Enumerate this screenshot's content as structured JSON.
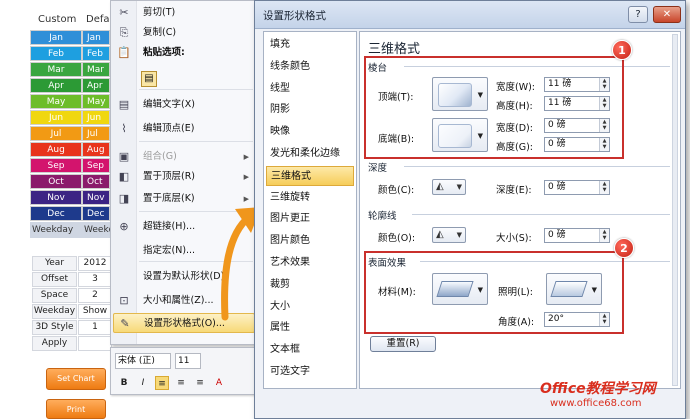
{
  "sheet": {
    "col_custom": "Custom",
    "col_default": "Defau",
    "months": [
      {
        "label": "Jan",
        "color": "#2f8fd8"
      },
      {
        "label": "Feb",
        "color": "#1e9fe0"
      },
      {
        "label": "Mar",
        "color": "#3aa640"
      },
      {
        "label": "Apr",
        "color": "#2c9a35"
      },
      {
        "label": "May",
        "color": "#6dbd2a"
      },
      {
        "label": "Jun",
        "color": "#f0d70f"
      },
      {
        "label": "Jul",
        "color": "#f29a14"
      },
      {
        "label": "Aug",
        "color": "#e8341c"
      },
      {
        "label": "Sep",
        "color": "#d3146d"
      },
      {
        "label": "Oct",
        "color": "#8b1a6b"
      },
      {
        "label": "Nov",
        "color": "#3c2484"
      },
      {
        "label": "Dec",
        "color": "#1e3a8c"
      }
    ],
    "months_default": [
      "Jan",
      "Feb",
      "Mar",
      "Apr",
      "May",
      "Jun",
      "Jul",
      "Aug",
      "Sep",
      "Oct",
      "Nov",
      "Dec"
    ],
    "weekday": "Weekday",
    "weekday2": "Weekd",
    "params": [
      {
        "label": "Year",
        "value": "2012"
      },
      {
        "label": "Offset",
        "value": "3"
      },
      {
        "label": "Space",
        "value": "2"
      },
      {
        "label": "Weekday",
        "value": "Show"
      },
      {
        "label": "3D Style",
        "value": "1"
      },
      {
        "label": "Apply",
        "value": ""
      }
    ],
    "set_chart": "Set Chart",
    "print": "Print"
  },
  "context_menu": {
    "items": [
      {
        "label": "剪切(T)",
        "icon": "✂",
        "name": "cut"
      },
      {
        "label": "复制(C)",
        "icon": "⎘",
        "name": "copy"
      },
      {
        "label": "粘贴选项:",
        "icon": "📋",
        "name": "paste-options"
      },
      {
        "label": "编辑文字(X)",
        "icon": "▤",
        "name": "edit-text"
      },
      {
        "label": "编辑顶点(E)",
        "icon": "⌇",
        "name": "edit-points"
      },
      {
        "label": "组合(G)",
        "icon": "▣",
        "name": "group"
      },
      {
        "label": "置于顶层(R)",
        "icon": "◧",
        "name": "bring-to-front"
      },
      {
        "label": "置于底层(K)",
        "icon": "◨",
        "name": "send-to-back"
      },
      {
        "label": "超链接(H)...",
        "icon": "⊕",
        "name": "hyperlink"
      },
      {
        "label": "指定宏(N)...",
        "icon": "",
        "name": "assign-macro"
      },
      {
        "label": "设置为默认形状(D)",
        "icon": "",
        "name": "set-default-shape"
      },
      {
        "label": "大小和属性(Z)...",
        "icon": "⊡",
        "name": "size-properties"
      },
      {
        "label": "设置形状格式(O)...",
        "icon": "✎",
        "name": "format-shape"
      }
    ]
  },
  "mini_toolbar": {
    "font": "宋体 (正)",
    "size": "11",
    "buttons": [
      "B",
      "I",
      "≡",
      "≡",
      "≡",
      "A"
    ]
  },
  "dialog": {
    "title": "设置形状格式",
    "help": "?",
    "close": "✕",
    "nav": [
      "填充",
      "线条颜色",
      "线型",
      "阴影",
      "映像",
      "发光和柔化边缘",
      "三维格式",
      "三维旋转",
      "图片更正",
      "图片颜色",
      "艺术效果",
      "裁剪",
      "大小",
      "属性",
      "文本框",
      "可选文字"
    ],
    "selected_nav": "三维格式",
    "section_title": "三维格式",
    "bevel": {
      "group": "棱台",
      "top": "顶端(T):",
      "bottom": "底端(B):",
      "width_label": "宽度(W):",
      "height_label": "高度(H):",
      "width2_label": "宽度(D):",
      "height2_label": "高度(G):",
      "top_width": "11 磅",
      "top_height": "11 磅",
      "bottom_width": "0 磅",
      "bottom_height": "0 磅"
    },
    "depth": {
      "group": "深度",
      "color_label": "颜色(C):",
      "depth_label": "深度(E):",
      "depth_value": "0 磅"
    },
    "contour": {
      "group": "轮廓线",
      "color_label": "颜色(O):",
      "size_label": "大小(S):",
      "size_value": "0 磅"
    },
    "surface": {
      "group": "表面效果",
      "material_label": "材料(M):",
      "lighting_label": "照明(L):",
      "angle_label": "角度(A):",
      "angle_value": "20°"
    },
    "reset": "重置(R)",
    "badges": [
      "1",
      "2"
    ]
  },
  "watermark": {
    "line1": "Office教程学习网",
    "line2": "www.office68.com"
  }
}
